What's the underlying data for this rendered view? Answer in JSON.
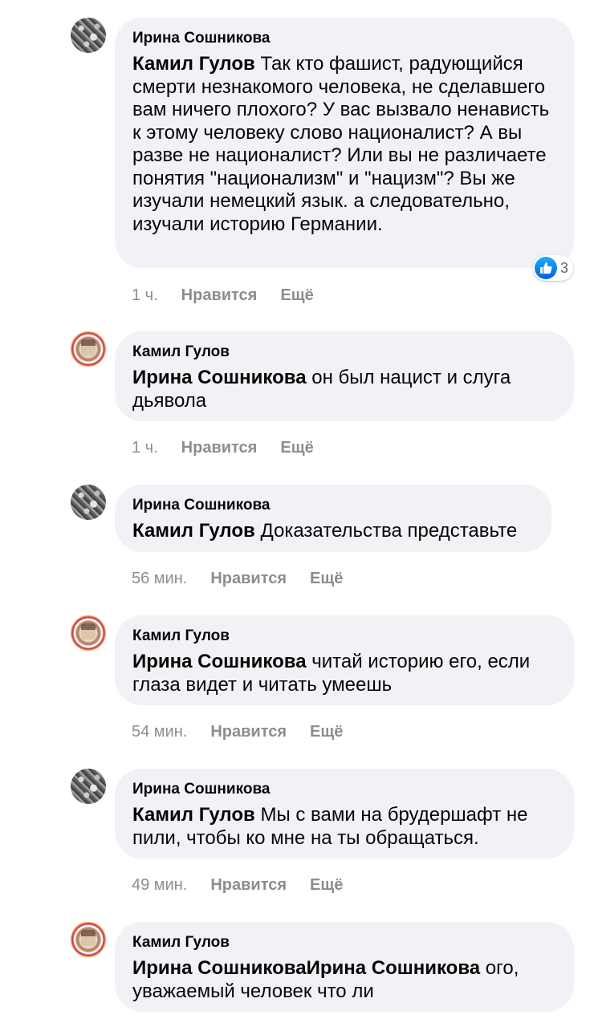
{
  "comments": [
    {
      "author": "Ирина Сошникова",
      "mention": "Камил Гулов",
      "text": " Так кто фашист, радующийся смерти незнакомого человека, не сделавшего вам ничего плохого? У вас вызвало ненависть к этому человеку слово националист? А вы разве не националист? Или вы не различаете понятия \"национализм\" и \"нацизм\"? Вы же изучали немецкий язык. а следовательно, изучали историю Германии.",
      "time": "1 ч.",
      "like_label": "Нравится",
      "more_label": "Ещё",
      "reaction_count": "3"
    },
    {
      "author": "Камил Гулов",
      "mention": "Ирина Сошникова",
      "text": " он был нацист и слуга дьявола",
      "time": "1 ч.",
      "like_label": "Нравится",
      "more_label": "Ещё"
    },
    {
      "author": "Ирина Сошникова",
      "mention": "Камил Гулов",
      "text": " Доказательства представьте",
      "time": "56 мин.",
      "like_label": "Нравится",
      "more_label": "Ещё"
    },
    {
      "author": "Камил Гулов",
      "mention": "Ирина Сошникова",
      "text": " читай историю его, если глаза видет и читать умеешь",
      "time": "54 мин.",
      "like_label": "Нравится",
      "more_label": "Ещё"
    },
    {
      "author": "Ирина Сошникова",
      "mention": "Камил Гулов",
      "text": " Мы с вами на брудершафт не пили, чтобы ко мне на ты обращаться.",
      "time": "49 мин.",
      "like_label": "Нравится",
      "more_label": "Ещё"
    },
    {
      "author": "Камил Гулов",
      "mention": "Ирина СошниковаИрина Сошникова",
      "text": " ого, уважаемый человек что ли"
    }
  ],
  "colors": {
    "bubble": "#f0f2f5",
    "meta_text": "#8a8d91",
    "like_blue": "#0571ed"
  }
}
